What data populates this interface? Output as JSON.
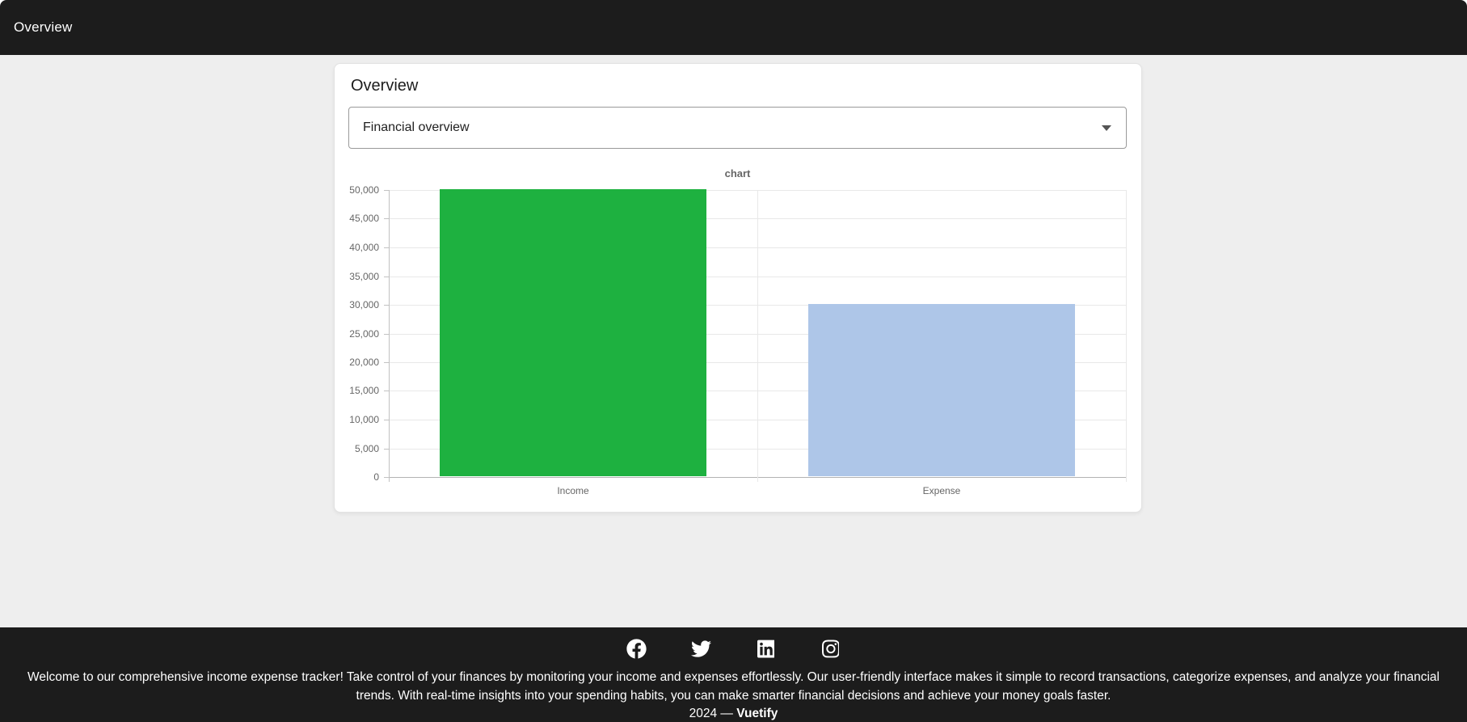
{
  "app_bar": {
    "title": "Overview"
  },
  "card": {
    "title": "Overview",
    "select": {
      "value": "Financial overview"
    }
  },
  "chart_data": {
    "type": "bar",
    "title": "chart",
    "categories": [
      "Income",
      "Expense"
    ],
    "values": [
      50000,
      30000
    ],
    "series_colors": [
      "#1eb140",
      "#aec6e8"
    ],
    "ylim": [
      0,
      50000
    ],
    "ytick_step": 5000,
    "xlabel": "",
    "ylabel": "",
    "grid": true,
    "legend": "none"
  },
  "footer": {
    "icons": [
      "facebook",
      "twitter",
      "linkedin",
      "instagram"
    ],
    "description": "Welcome to our comprehensive income expense tracker! Take control of your finances by monitoring your income and expenses effortlessly. Our user-friendly interface makes it simple to record transactions, categorize expenses, and analyze your financial trends. With real-time insights into your spending habits, you can make smarter financial decisions and achieve your money goals faster.",
    "copyright_prefix": "2024 —",
    "brand": "Vuetify"
  },
  "colors": {
    "app_bar_bg": "#1c1c1c",
    "footer_bg": "#1c1c1c",
    "page_bg": "#eeeeee",
    "income_bar": "#1eb140",
    "expense_bar": "#aec6e8"
  }
}
